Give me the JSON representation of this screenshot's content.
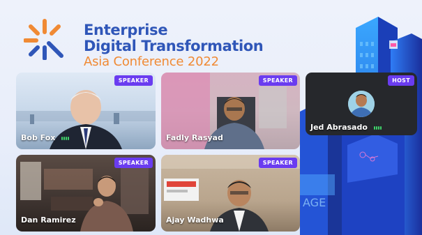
{
  "event": {
    "title_line1": "Enterprise",
    "title_line2": "Digital Transformation",
    "title_line3": "Asia Conference 2022"
  },
  "participants": [
    {
      "name": "Bob Fox",
      "role": "SPEAKER"
    },
    {
      "name": "Fadly Rasyad",
      "role": "SPEAKER"
    },
    {
      "name": "Jed Abrasado",
      "role": "HOST"
    },
    {
      "name": "Dan Ramirez",
      "role": "SPEAKER"
    },
    {
      "name": "Ajay Wadhwa",
      "role": "SPEAKER"
    }
  ],
  "colors": {
    "title_blue": "#2f56b8",
    "title_orange": "#f08a34",
    "badge_purple": "#6a3cf0",
    "mic_green": "#3fd46a"
  },
  "icons": [
    "logo-starburst-icon",
    "mic-active-icon"
  ]
}
